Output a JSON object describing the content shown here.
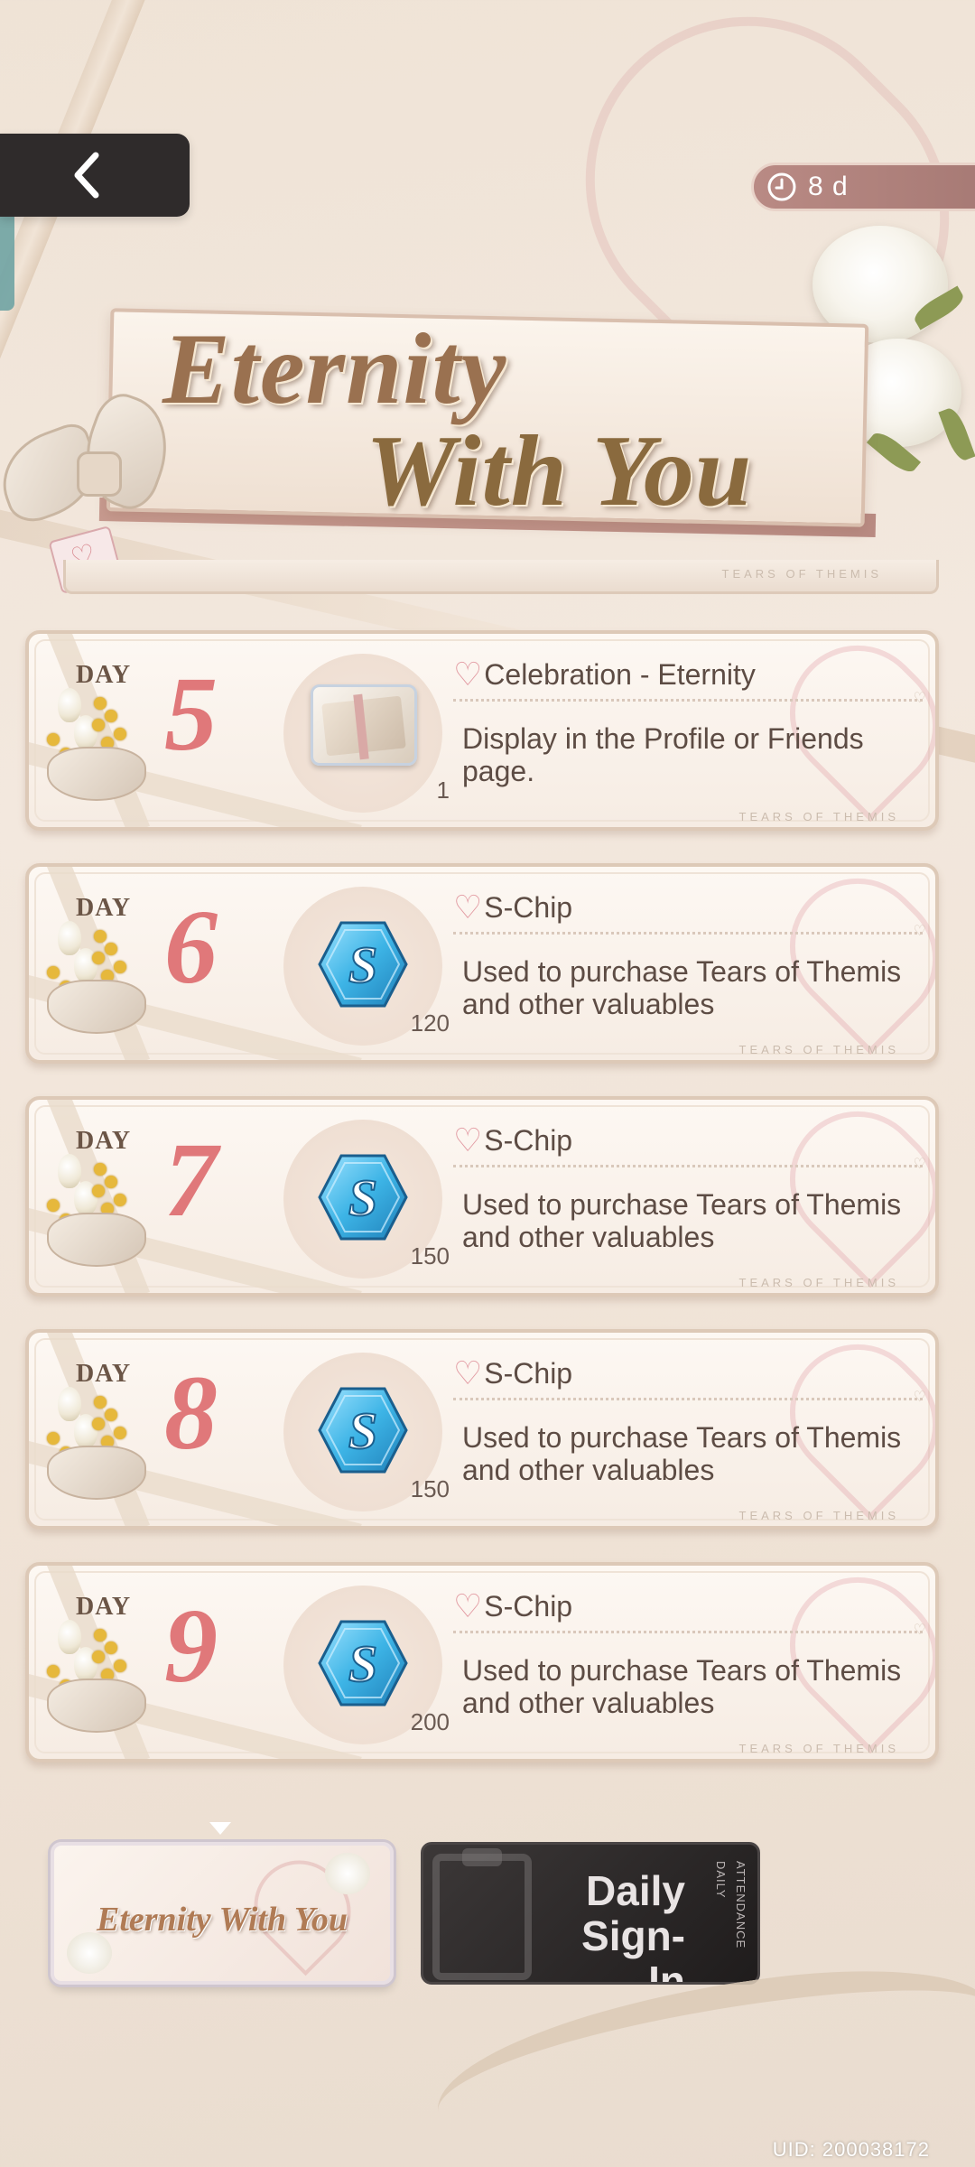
{
  "header": {
    "back_label": "",
    "timer": "8 d",
    "title_line1": "Eternity",
    "title_line2": "With You",
    "watermark": "TEARS OF THEMIS"
  },
  "rewards": [
    {
      "day_label": "DAY",
      "day": "5",
      "item": "Celebration - Eternity",
      "desc": "Display in the Profile or Friends page.",
      "qty": "1",
      "icon": "gift-box-icon"
    },
    {
      "day_label": "DAY",
      "day": "6",
      "item": "S-Chip",
      "desc": "Used to purchase Tears of Themis and other valuables",
      "qty": "120",
      "icon": "s-chip-icon"
    },
    {
      "day_label": "DAY",
      "day": "7",
      "item": "S-Chip",
      "desc": "Used to purchase Tears of Themis and other valuables",
      "qty": "150",
      "icon": "s-chip-icon"
    },
    {
      "day_label": "DAY",
      "day": "8",
      "item": "S-Chip",
      "desc": "Used to purchase Tears of Themis and other valuables",
      "qty": "150",
      "icon": "s-chip-icon"
    },
    {
      "day_label": "DAY",
      "day": "9",
      "item": "S-Chip",
      "desc": "Used to purchase Tears of Themis and other valuables",
      "qty": "200",
      "icon": "s-chip-icon"
    }
  ],
  "tabs": {
    "active": "Eternity With You",
    "inactive_line1": "Daily",
    "inactive_line2": "Sign-In",
    "inactive_vertical1": "ATTENDANCE",
    "inactive_vertical2": "DAILY"
  },
  "footer": {
    "uid": "UID: 200038172"
  },
  "colors": {
    "accent": "#e0787a",
    "timer_bg": "#b98a84",
    "chip_blue": "#3db4e6"
  }
}
